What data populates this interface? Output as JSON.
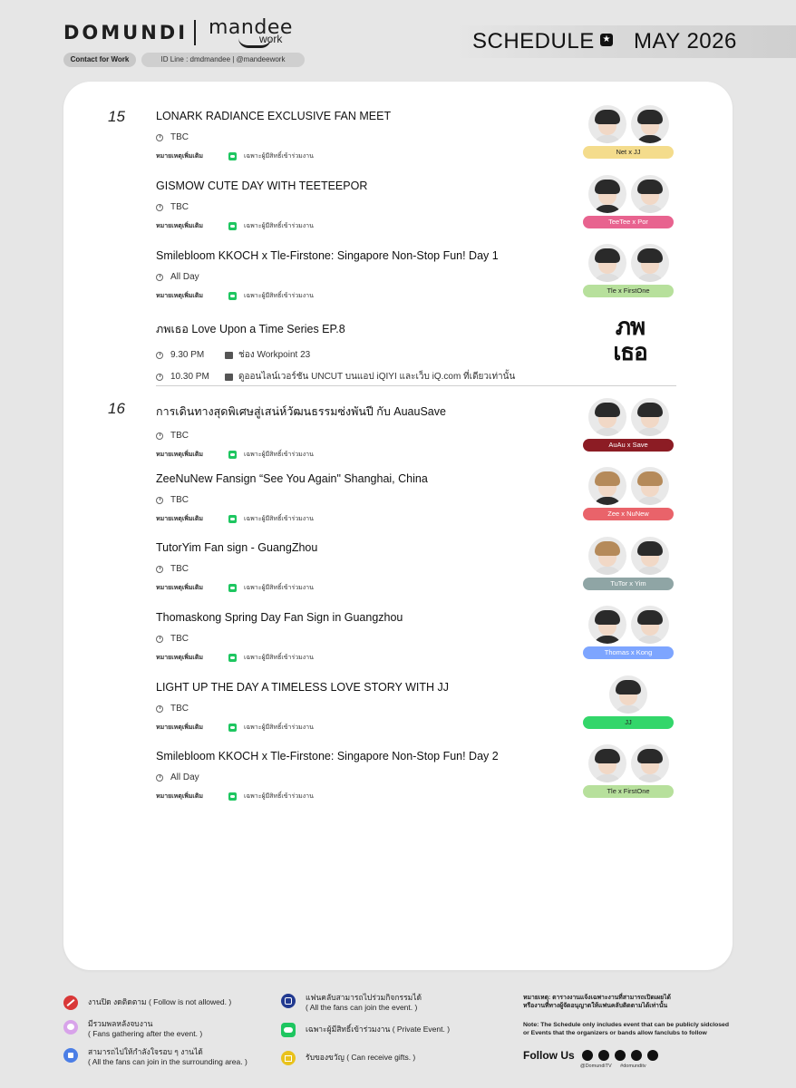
{
  "header": {
    "brand": "DOMUNDI",
    "brand2": "mandee",
    "brand2_sub": "work",
    "contact_btn": "Contact for Work",
    "id_line": "ID Line : dmdmandee | @mandeework",
    "schedule_title": "SCHEDULE",
    "month": "MAY 2026",
    "star_icon": "star-icon"
  },
  "labels": {
    "note": "หมายเหตุเพิ่มเติม",
    "private": "เฉพาะผู้มีสิทธิ์เข้าร่วมงาน"
  },
  "days": [
    {
      "day": "15",
      "events": [
        {
          "title": "LONARK RADIANCE EXCLUSIVE FAN MEET",
          "time": "TBC",
          "artists": "Net  x  JJ",
          "color": "#f4dc8c",
          "text_color": "#222"
        },
        {
          "title": "GISMOW CUTE DAY WITH TEETEEPOR",
          "time": "TBC",
          "artists": "TeeTee  x  Por",
          "color": "#e8638f",
          "text_color": "#fff"
        },
        {
          "title": "Smilebloom KKOCH x Tle-Firstone: Singapore Non-Stop Fun! Day 1",
          "time": "All Day",
          "artists": "Tle  x  FirstOne",
          "color": "#b7e09c",
          "text_color": "#222"
        },
        {
          "title": "ภพเธอ Love Upon a Time Series EP.8",
          "broadcast": [
            {
              "time": "9.30 PM",
              "icon": "tv-icon",
              "text": "ช่อง Workpoint 23"
            },
            {
              "time": "10.30 PM",
              "icon": "camera-icon",
              "text": "ดูออนไลน์เวอร์ชัน UNCUT บนแอป  iQIYI และเว็บ iQ.com ที่เดียวเท่านั้น"
            }
          ],
          "logo_line1": "ภพ",
          "logo_line2": "เธอ"
        }
      ]
    },
    {
      "day": "16",
      "events": [
        {
          "title": "การเดินทางสุดพิเศษสู่เสน่ห์วัฒนธรรมซ่งพันปี กับ AuauSave",
          "time": "TBC",
          "artists": "AuAu  x  Save",
          "color": "#8c1c24",
          "text_color": "#fff"
        },
        {
          "title": "ZeeNuNew Fansign “See You Again\" Shanghai, China",
          "time": "TBC",
          "artists": "Zee  x  NuNew",
          "color": "#e9636a",
          "text_color": "#fff"
        },
        {
          "title": "TutorYim Fan sign - GuangZhou",
          "time": "TBC",
          "artists": "TuTor  x  Yim",
          "color": "#8fa5a5",
          "text_color": "#fff"
        },
        {
          "title": "Thomaskong Spring Day Fan Sign in Guangzhou",
          "time": "TBC",
          "artists": "Thomas  x  Kong",
          "color": "#7da5ff",
          "text_color": "#fff"
        },
        {
          "title": "LIGHT UP THE DAY A TIMELESS LOVE STORY WITH JJ",
          "time": "TBC",
          "artists": "JJ",
          "color": "#33d66a",
          "text_color": "#222"
        },
        {
          "title": "Smilebloom KKOCH x Tle-Firstone: Singapore Non-Stop Fun! Day 2",
          "time": "All Day",
          "artists": "Tle  x  FirstOne",
          "color": "#b7e09c",
          "text_color": "#222"
        }
      ]
    }
  ],
  "legend": [
    {
      "icon": "no-entry-icon",
      "l1": "งานปิด งดติดตาม ( Follow is not allowed. )",
      "l2": ""
    },
    {
      "icon": "chat-bubble-icon",
      "l1": "มีรวมพลหลังจบงาน",
      "l2": "( Fans gathering after the event. )"
    },
    {
      "icon": "thumbs-up-icon",
      "l1": "สามารถไปให้กำลังใจรอบ ๆ งานได้",
      "l2": "( All the fans can join in the surrounding area. )"
    },
    {
      "icon": "shield-icon",
      "l1": "แฟนคลับสามารถไปร่วมกิจกรรมได้",
      "l2": "( All the fans can join the event. )"
    },
    {
      "icon": "line-icon",
      "l1": "เฉพาะผู้มีสิทธิ์เข้าร่วมงาน ( Private Event. )",
      "l2": ""
    },
    {
      "icon": "gift-icon",
      "l1": "รับของขวัญ ( Can receive gifts. )",
      "l2": ""
    }
  ],
  "footnote_th": [
    "หมายเหตุ: ตารางงานแจ้งเฉพาะงานที่สามารถเปิดเผยได้",
    "หรืองานที่ทางผู้จัดอนุญาตให้แฟนคลับติดตามได้เท่านั้น"
  ],
  "footnote_en": [
    "Note: The Schedule only includes event that can be publicly sidclosed",
    "or Events that the organizers or bands allow fanclubs to follow"
  ],
  "follow": {
    "label": "Follow Us",
    "handle1": "@DomundiTV",
    "handle2": "#domunditv",
    "icons": [
      "instagram-icon",
      "x-icon",
      "facebook-icon",
      "youtube-icon",
      "tiktok-icon"
    ]
  }
}
